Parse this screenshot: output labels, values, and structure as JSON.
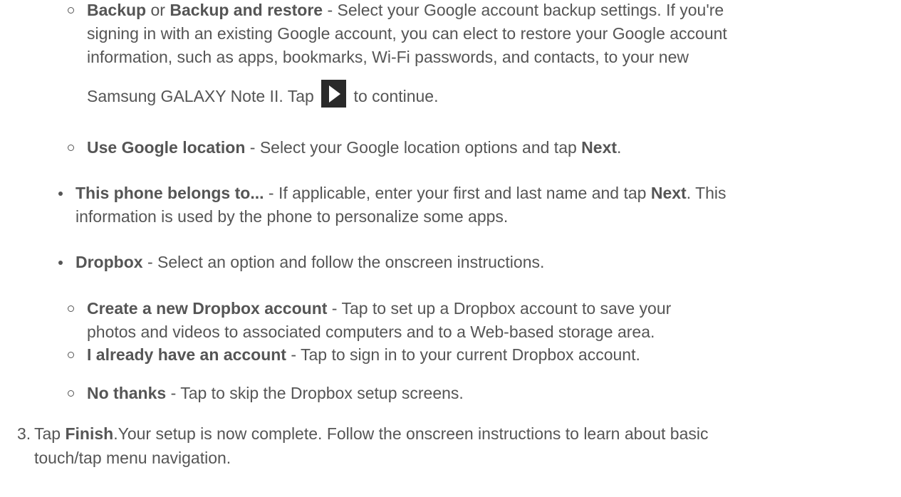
{
  "backup": {
    "title1": "Backup",
    "connector": " or ",
    "title2": "Backup and restore",
    "desc_line1": " - Select your Google account backup settings. If you're",
    "desc_line2": "signing in with an existing Google account, you can elect to restore your Google account",
    "desc_line3": "information, such as apps, bookmarks, Wi-Fi passwords, and contacts, to your new",
    "desc_line4_pre": "Samsung GALAXY Note II. Tap ",
    "desc_line4_post": " to continue.",
    "icon": "play-icon"
  },
  "location": {
    "title": "Use Google location",
    "desc_pre": " - Select your Google location options and tap ",
    "desc_bold": "Next",
    "desc_post": "."
  },
  "owner": {
    "title": "This phone belongs to...",
    "desc_pre": " - If applicable, enter your first and last name and tap ",
    "desc_bold": "Next",
    "desc_post": ". This",
    "desc_line2": "information is used by the phone to personalize some apps."
  },
  "dropbox": {
    "title": "Dropbox",
    "desc": " - Select an option and follow the onscreen instructions."
  },
  "dropbox_options": [
    {
      "title": "Create a new Dropbox account",
      "desc_line1": " - Tap to set up a Dropbox account to save your",
      "desc_line2": "photos and videos to associated computers and to a Web-based storage area."
    },
    {
      "title": "I already have an account",
      "desc_line1": " - Tap to sign in to your current Dropbox account."
    },
    {
      "title": "No thanks",
      "desc_line1": " - Tap to skip the Dropbox setup screens."
    }
  ],
  "step3": {
    "number": "3.",
    "pre": "Tap ",
    "bold": "Finish",
    "post_line1": ".Your setup is now complete. Follow the onscreen instructions to learn about basic",
    "line2": "touch/tap menu navigation."
  }
}
